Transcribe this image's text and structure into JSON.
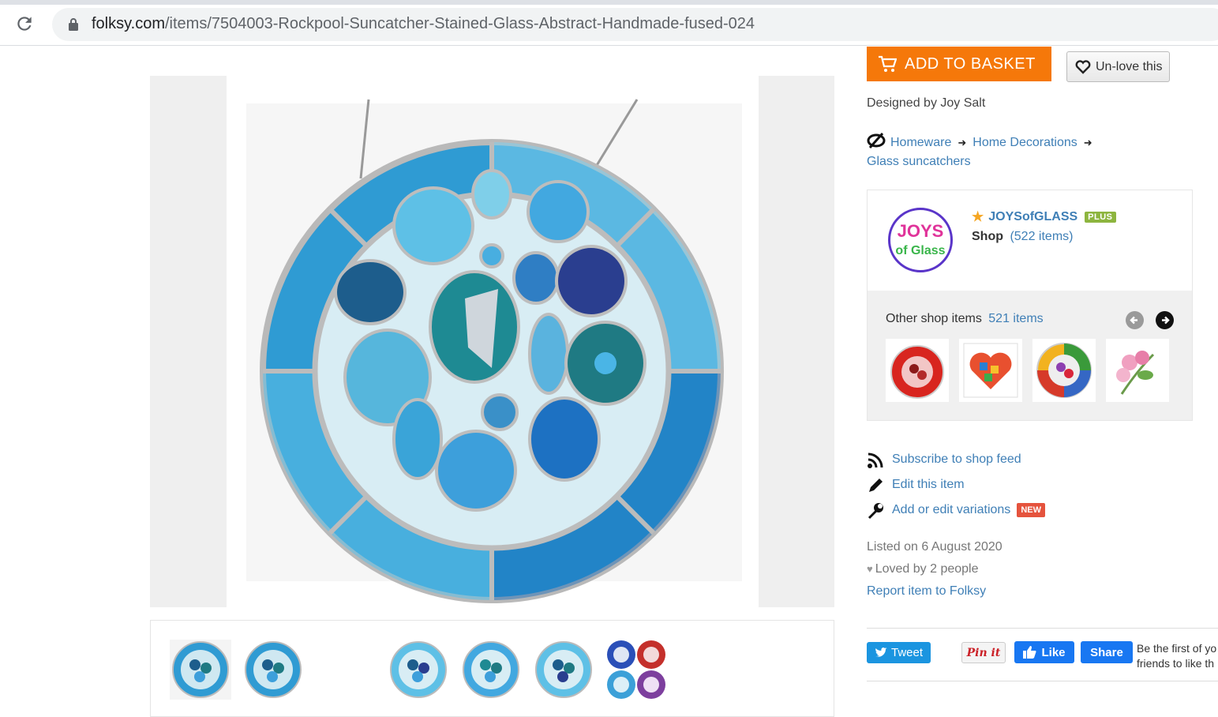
{
  "browser": {
    "url_host": "folksy.com",
    "url_path": "/items/7504003-Rockpool-Suncatcher-Stained-Glass-Abstract-Handmade-fused-024"
  },
  "item": {
    "title_fragment": "fused 024"
  },
  "actions": {
    "add_to_basket": "ADD TO BASKET",
    "unlove": "Un-love this"
  },
  "designer": "Designed by Joy Salt",
  "breadcrumb": {
    "items": [
      "Homeware",
      "Home Decorations",
      "Glass suncatchers"
    ]
  },
  "shop": {
    "name": "JOYSofGLASS",
    "plus_badge": "PLUS",
    "label": "Shop",
    "count": "(522 items)",
    "logo_text": "JOYS of Glass",
    "other_label": "Other shop items",
    "other_count": "521 items"
  },
  "links": {
    "subscribe": "Subscribe to shop feed",
    "edit": "Edit this item",
    "variations": "Add or edit variations",
    "new_badge": "NEW"
  },
  "meta": {
    "listed": "Listed on 6 August 2020",
    "loved": "Loved by 2 people",
    "report": "Report item to Folksy"
  },
  "social": {
    "tweet": "Tweet",
    "pin": "Pin it",
    "like": "Like",
    "share": "Share",
    "fb_text_line1": "Be the first of yo",
    "fb_text_line2": "friends to like th"
  },
  "colors": {
    "accent": "#f5780a",
    "link": "#3f7fb6",
    "plus": "#8db53f",
    "new": "#e5533d",
    "twitter": "#1b95e0",
    "facebook": "#1877f2"
  }
}
